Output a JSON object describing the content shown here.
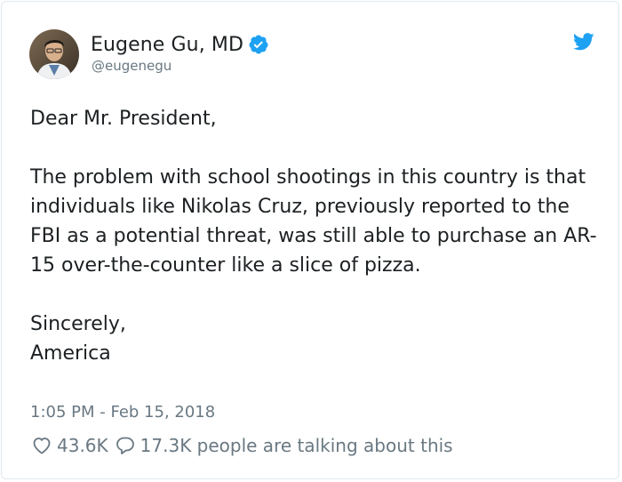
{
  "tweet": {
    "author": {
      "name": "Eugene Gu, MD",
      "handle": "@eugenegu",
      "verified": true
    },
    "body": {
      "greeting": "Dear Mr. President,",
      "paragraph": "The problem with school shootings in this country is that individuals like Nikolas Cruz, previously reported to the FBI as a potential threat, was still able to purchase an AR-15 over-the-counter like a slice of pizza.",
      "closing": "Sincerely,",
      "signature": "America"
    },
    "timestamp": "1:05 PM - Feb 15, 2018",
    "likes": "43.6K",
    "replies": "17.3K people are talking about this"
  },
  "colors": {
    "twitter_blue": "#1da1f2",
    "text": "#1c2022",
    "muted": "#697882",
    "border": "#e1e8ed"
  },
  "icons": {
    "verified": "verified-badge-icon",
    "brand": "twitter-bird-icon",
    "like": "heart-icon",
    "reply": "speech-bubble-icon"
  }
}
